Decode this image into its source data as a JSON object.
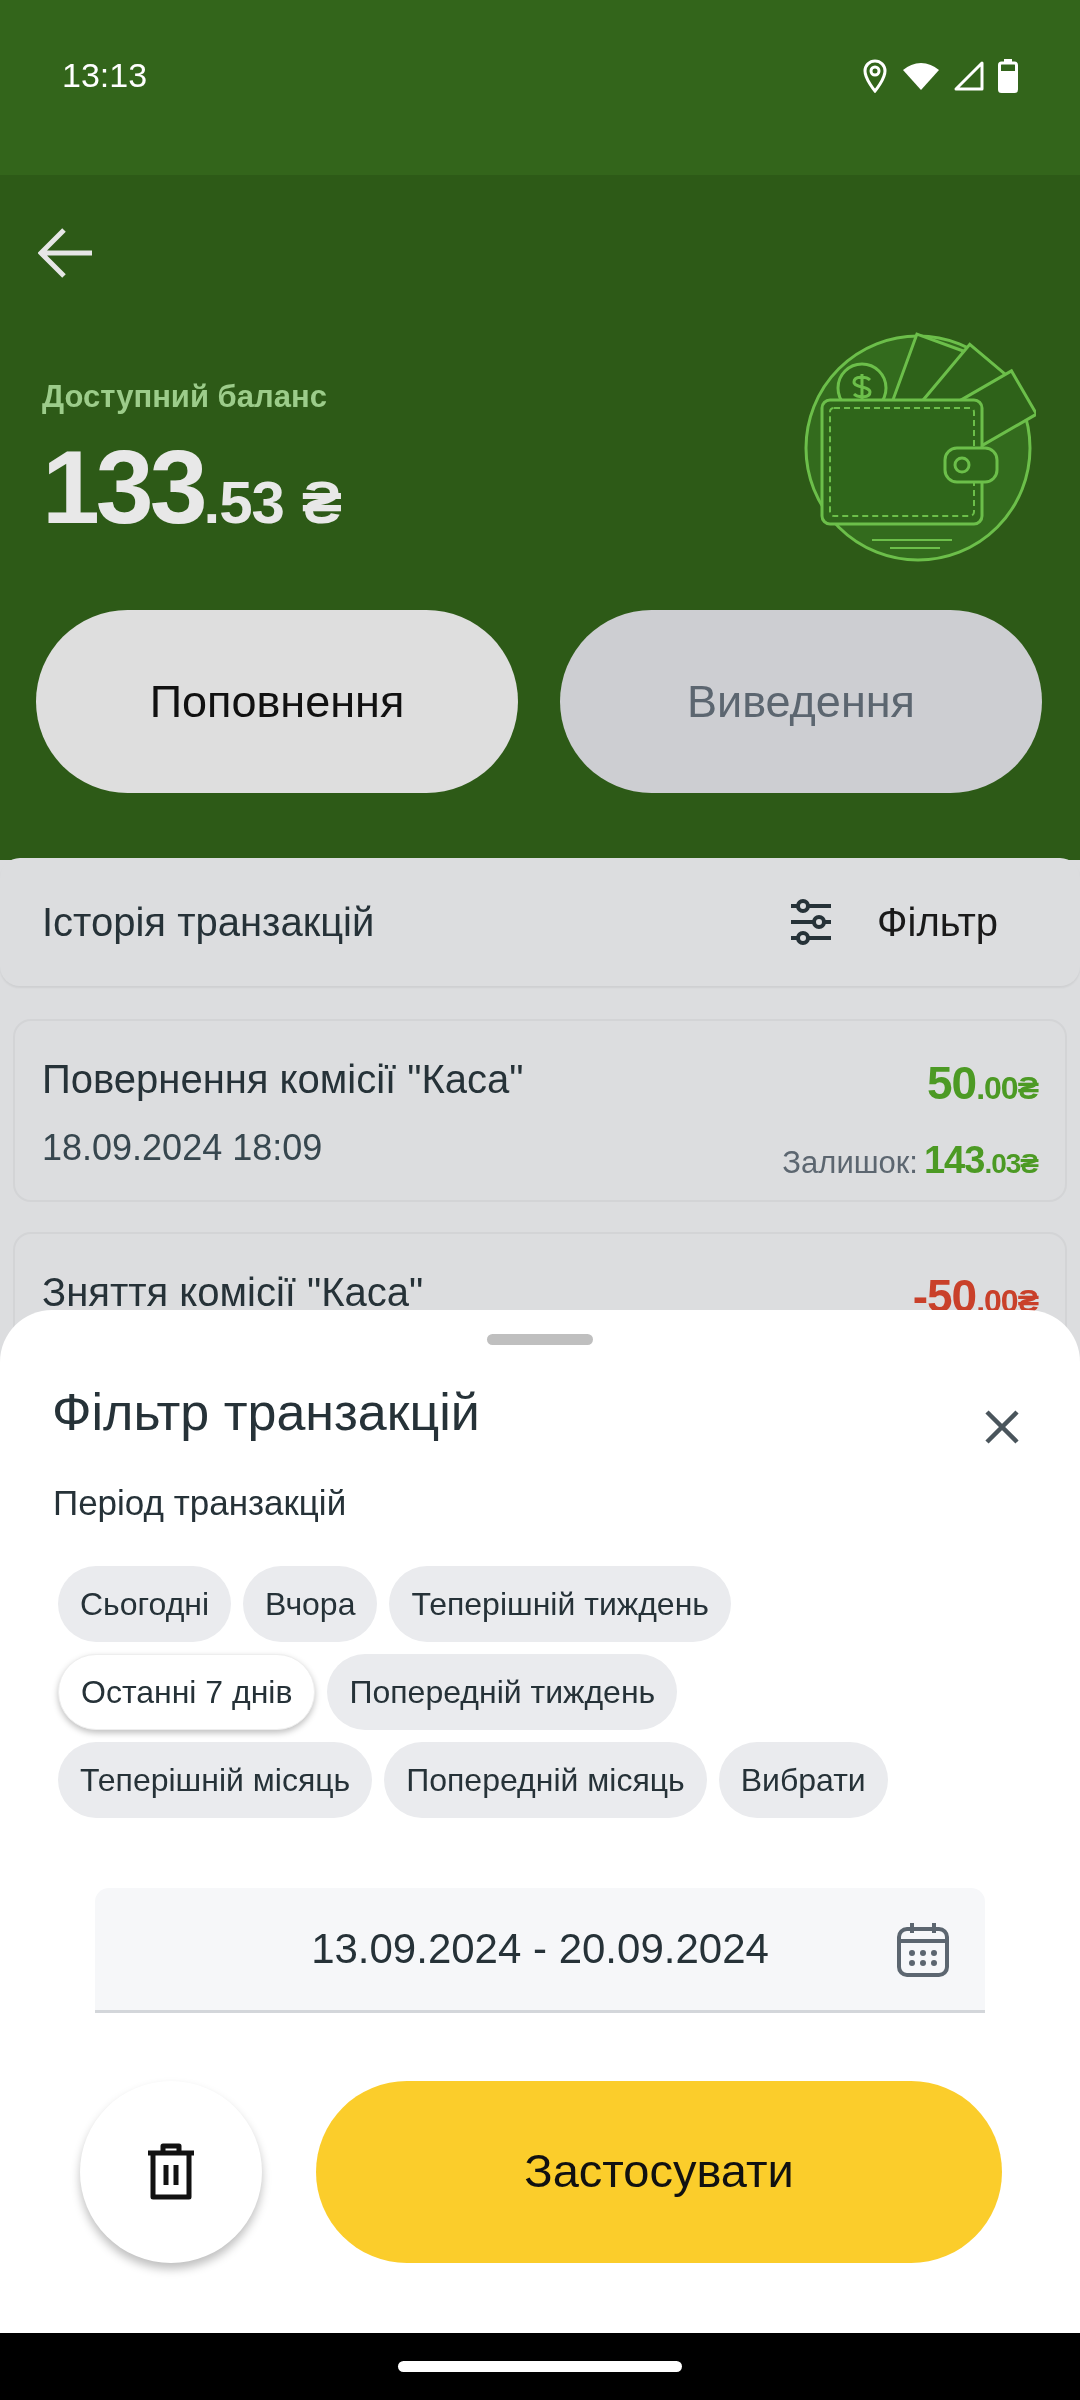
{
  "status_bar": {
    "time": "13:13"
  },
  "balance": {
    "label": "Доступний баланс",
    "whole": "133",
    "fraction": ".53",
    "currency": "₴"
  },
  "actions": [
    {
      "label": "Поповнення",
      "disabled": false
    },
    {
      "label": "Виведення",
      "disabled": true
    }
  ],
  "history": {
    "title": "Історія транзакцій",
    "filter_label": "Фільтр",
    "transactions": [
      {
        "kind": "credit",
        "title": "Повернення комісії \"Каса\"",
        "date": "18.09.2024 18:09",
        "whole": "50",
        "fraction": ".00₴",
        "rest_label": "Залишок:",
        "rest_whole": "143",
        "rest_fraction": ".03₴"
      },
      {
        "kind": "debit",
        "title": "Зняття комісії \"Каса\"",
        "whole": "-50",
        "fraction": ".00₴"
      }
    ]
  },
  "filter_sheet": {
    "title": "Фільтр транзакцій",
    "period_label": "Період транзакцій",
    "chips": [
      [
        {
          "label": "Сьогодні",
          "selected": false
        },
        {
          "label": "Вчора",
          "selected": false
        },
        {
          "label": "Теперішній тиждень",
          "selected": false
        }
      ],
      [
        {
          "label": "Останні 7 днів",
          "selected": true
        },
        {
          "label": "Попередній тиждень",
          "selected": false
        }
      ],
      [
        {
          "label": "Теперішній місяць",
          "selected": false
        },
        {
          "label": "Попередній місяць",
          "selected": false
        },
        {
          "label": "Вибрати",
          "selected": false
        }
      ]
    ],
    "date_range": "13.09.2024 - 20.09.2024",
    "apply_label": "Застосувати"
  }
}
